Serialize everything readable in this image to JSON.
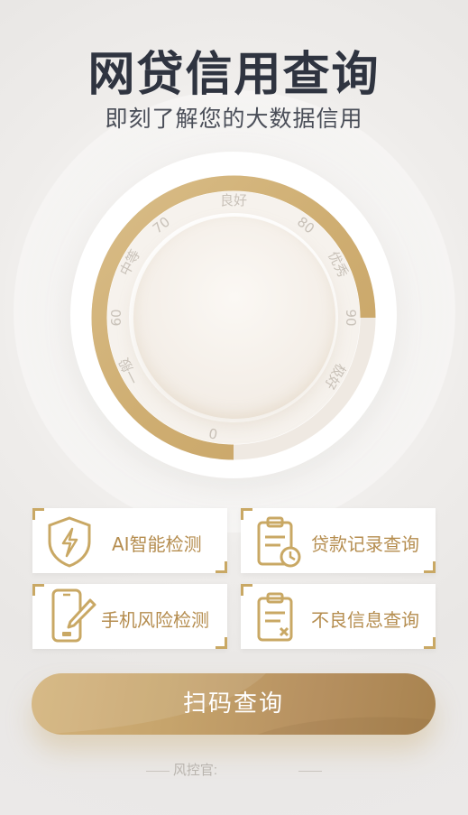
{
  "header": {
    "title": "网贷信用查询",
    "subtitle": "即刻了解您的大数据信用"
  },
  "gauge": {
    "labels": [
      "一般",
      "60",
      "中等",
      "70",
      "良好",
      "80",
      "优秀",
      "90",
      "极好",
      "0"
    ],
    "progress_fraction": 0.75,
    "accent_color": "#d4b277"
  },
  "cards": [
    {
      "label": "AI智能检测",
      "icon": "shield-lightning-icon"
    },
    {
      "label": "贷款记录查询",
      "icon": "clipboard-clock-icon"
    },
    {
      "label": "手机风险检测",
      "icon": "phone-pen-icon"
    },
    {
      "label": "不良信息查询",
      "icon": "clipboard-x-icon"
    }
  ],
  "scan_button": {
    "label": "扫码查询"
  },
  "footer": {
    "label": "风控官:"
  },
  "colors": {
    "gold": "#c9a864",
    "text_gold": "#b58d4f",
    "title": "#2f3440"
  }
}
